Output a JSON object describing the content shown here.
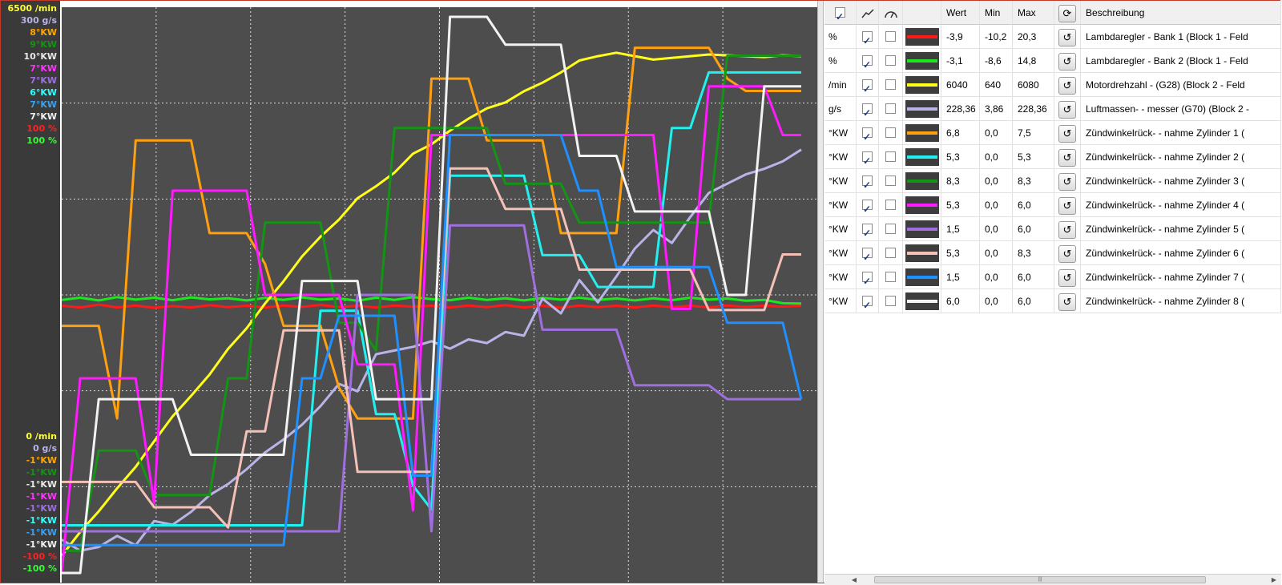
{
  "axis_labels_top": [
    {
      "text": "6500 /min",
      "color": "#ffff33"
    },
    {
      "text": "300 g/s",
      "color": "#b8b4e8"
    },
    {
      "text": "8°KW",
      "color": "#ffa500"
    },
    {
      "text": "9°KW",
      "color": "#149414"
    },
    {
      "text": "10°KW",
      "color": "#e8e8e8"
    },
    {
      "text": "7°KW",
      "color": "#ff33ff"
    },
    {
      "text": "7°KW",
      "color": "#9f6fe0"
    },
    {
      "text": "6°KW",
      "color": "#33ffff"
    },
    {
      "text": "7°KW",
      "color": "#3aa0f0"
    },
    {
      "text": "7°KW",
      "color": "#f0f0f0"
    },
    {
      "text": "100 %",
      "color": "#ff2020"
    },
    {
      "text": "100 %",
      "color": "#33ff33"
    }
  ],
  "axis_labels_bottom": [
    {
      "text": "0 /min",
      "color": "#ffff33"
    },
    {
      "text": "0 g/s",
      "color": "#b8b4e8"
    },
    {
      "text": "-1°KW",
      "color": "#ffa500"
    },
    {
      "text": "-1°KW",
      "color": "#149414"
    },
    {
      "text": "-1°KW",
      "color": "#e8e8e8"
    },
    {
      "text": "-1°KW",
      "color": "#ff33ff"
    },
    {
      "text": "-1°KW",
      "color": "#9f6fe0"
    },
    {
      "text": "-1°KW",
      "color": "#33ffff"
    },
    {
      "text": "-1°KW",
      "color": "#3aa0f0"
    },
    {
      "text": "-1°KW",
      "color": "#f0f0f0"
    },
    {
      "text": "-100 %",
      "color": "#ff2020"
    },
    {
      "text": "-100 %",
      "color": "#33ff33"
    }
  ],
  "chart_data": {
    "type": "line",
    "grid": true,
    "x": [
      0,
      2,
      4,
      6,
      8,
      10,
      12,
      14,
      16,
      18,
      20,
      22,
      24,
      26,
      28,
      30,
      32,
      34,
      36,
      38,
      40,
      42,
      44,
      46,
      48,
      50,
      52,
      54,
      56,
      58,
      60,
      62,
      64,
      66,
      68,
      70,
      72,
      74,
      76,
      78,
      80
    ],
    "series": [
      {
        "name": "Lambdaregler - Bank 1",
        "color": "#ff1a1a",
        "values": [
          -3.9,
          -4.5,
          -3.5,
          -4.5,
          -3.8,
          -4.6,
          -4.0,
          -4.5,
          -3.7,
          -4.4,
          -3.9,
          -4.5,
          -3.8,
          -4.3,
          -3.6,
          -4.4,
          -3.9,
          -4.5,
          -3.8,
          -4.2,
          -3.9,
          -4.5,
          -3.8,
          -4.4,
          -3.7,
          -4.5,
          -3.9,
          -4.6,
          -3.8,
          -4.4,
          -3.9,
          -4.5,
          -3.8,
          -4.4,
          -3.9,
          -4.5,
          -3.8,
          -4.3,
          -3.9,
          -4.2,
          -3.9
        ]
      },
      {
        "name": "Lambdaregler - Bank 2",
        "color": "#1ee61e",
        "values": [
          -1.8,
          -1.0,
          -2.0,
          -0.8,
          -1.7,
          -1.0,
          -1.9,
          -0.9,
          -1.6,
          -1.2,
          -2.0,
          -1.1,
          -1.8,
          -0.9,
          -1.7,
          -1.3,
          -2.1,
          -1.0,
          -1.8,
          -0.8,
          -1.5,
          -1.9,
          -1.0,
          -1.8,
          -1.2,
          -2.0,
          -1.1,
          -1.7,
          -1.0,
          -1.8,
          -1.3,
          -2.0,
          -1.2,
          -1.9,
          -1.0,
          -1.7,
          -1.3,
          -2.1,
          -1.8,
          -3.0,
          -3.1
        ]
      },
      {
        "name": "Motordrehzahl - (G28)",
        "color": "#ffff1a",
        "values": [
          200,
          480,
          720,
          990,
          1240,
          1540,
          1830,
          2070,
          2320,
          2620,
          2860,
          3150,
          3410,
          3700,
          3930,
          4130,
          4380,
          4520,
          4680,
          4900,
          5010,
          5170,
          5310,
          5430,
          5500,
          5630,
          5730,
          5850,
          5990,
          6040,
          6080,
          6040,
          6000,
          6020,
          6040,
          6060,
          6050,
          6040,
          6030,
          6050,
          6040
        ]
      },
      {
        "name": "Luftmassen- - messer (G70)",
        "color": "#b8b4e8",
        "values": [
          18,
          12,
          14,
          20,
          15,
          28,
          26,
          33,
          42,
          48,
          56,
          65,
          72,
          80,
          90,
          102,
          98,
          118,
          120,
          122,
          125,
          121,
          126,
          124,
          130,
          128,
          148,
          140,
          158,
          146,
          160,
          175,
          185,
          178,
          192,
          205,
          210,
          215,
          218,
          222,
          228.36
        ]
      },
      {
        "name": "Zündwinkelrück- - nahme Zylinder 1",
        "color": "#ffa010",
        "values": [
          3.0,
          3.0,
          3.0,
          1.5,
          6.0,
          6.0,
          6.0,
          6.0,
          4.5,
          4.5,
          4.5,
          4.0,
          3.0,
          3.0,
          3.0,
          2.0,
          1.5,
          1.5,
          1.5,
          1.5,
          7.0,
          7.0,
          7.0,
          6.0,
          6.0,
          6.0,
          6.0,
          4.5,
          4.5,
          4.5,
          4.5,
          7.5,
          7.5,
          7.5,
          7.5,
          7.5,
          7.0,
          6.8,
          6.8,
          6.8,
          6.8
        ]
      },
      {
        "name": "Zündwinkelrück- - nahme Zylinder 2",
        "color": "#22f0f0",
        "values": [
          -0.4,
          -0.4,
          -0.4,
          -0.4,
          -0.4,
          -0.4,
          -0.4,
          -0.4,
          -0.4,
          -0.4,
          -0.4,
          -0.4,
          -0.4,
          -0.4,
          2.3,
          2.3,
          2.3,
          1.0,
          1.0,
          0.1,
          -0.2,
          4.0,
          4.0,
          4.0,
          4.0,
          4.0,
          3.0,
          3.0,
          3.0,
          2.6,
          2.6,
          2.6,
          2.6,
          4.6,
          4.6,
          5.3,
          5.3,
          5.3,
          5.3,
          5.3,
          5.3
        ]
      },
      {
        "name": "Zündwinkelrück- - nahme Zylinder 3",
        "color": "#149414",
        "values": [
          -0.6,
          -0.6,
          1.2,
          1.2,
          1.2,
          0.4,
          0.4,
          0.4,
          0.4,
          2.5,
          2.5,
          5.3,
          5.3,
          5.3,
          5.3,
          3.5,
          3.5,
          3.0,
          7.0,
          7.0,
          7.0,
          7.0,
          7.0,
          7.0,
          6.0,
          6.0,
          6.0,
          6.0,
          5.3,
          5.3,
          5.3,
          5.3,
          5.3,
          5.3,
          5.3,
          5.3,
          8.3,
          8.3,
          8.3,
          8.3,
          8.3
        ]
      },
      {
        "name": "Zündwinkelrück- - nahme Zylinder 4",
        "color": "#ff1aff",
        "values": [
          -1.0,
          1.8,
          1.8,
          1.8,
          1.8,
          0.0,
          4.5,
          4.5,
          4.5,
          4.5,
          4.5,
          3.0,
          3.0,
          3.0,
          3.0,
          3.0,
          2.0,
          2.0,
          2.0,
          -0.1,
          5.3,
          5.3,
          5.3,
          5.3,
          5.3,
          5.3,
          5.3,
          5.3,
          5.3,
          5.3,
          5.3,
          5.3,
          5.3,
          2.8,
          2.8,
          6.0,
          6.0,
          6.0,
          6.0,
          5.3,
          5.3
        ]
      },
      {
        "name": "Zündwinkelrück- - nahme Zylinder 5",
        "color": "#9f6fe0",
        "values": [
          -0.4,
          -0.4,
          -0.4,
          -0.4,
          -0.4,
          -0.4,
          -0.4,
          -0.4,
          -0.4,
          -0.4,
          -0.4,
          -0.4,
          -0.4,
          -0.4,
          -0.4,
          -0.4,
          3.0,
          3.0,
          3.0,
          3.0,
          -0.4,
          4.0,
          4.0,
          4.0,
          4.0,
          4.0,
          2.5,
          2.5,
          2.5,
          2.5,
          2.5,
          1.7,
          1.7,
          1.7,
          1.7,
          1.7,
          1.5,
          1.5,
          1.5,
          1.5,
          1.5
        ]
      },
      {
        "name": "Zündwinkelrück- - nahme Zylinder 6",
        "color": "#f5c0b5",
        "values": [
          0.8,
          0.8,
          0.8,
          0.8,
          0.8,
          0.3,
          0.3,
          0.3,
          0.3,
          -0.1,
          1.8,
          1.8,
          3.8,
          3.8,
          3.8,
          3.8,
          1.0,
          1.0,
          1.0,
          1.0,
          1.0,
          7.0,
          7.0,
          7.0,
          6.2,
          6.2,
          6.2,
          6.2,
          5.0,
          5.0,
          5.0,
          5.0,
          5.0,
          5.0,
          5.0,
          4.2,
          4.2,
          4.2,
          4.2,
          5.3,
          5.3
        ]
      },
      {
        "name": "Zündwinkelrück- - nahme Zylinder 7",
        "color": "#1e90ff",
        "values": [
          -0.6,
          -0.6,
          -0.6,
          -0.6,
          -0.6,
          -0.6,
          -0.6,
          -0.6,
          -0.6,
          -0.6,
          -0.6,
          -0.6,
          -0.6,
          1.8,
          1.8,
          2.7,
          2.7,
          2.7,
          2.7,
          0.4,
          0.4,
          5.3,
          5.3,
          5.3,
          5.3,
          5.3,
          5.3,
          5.3,
          4.5,
          4.5,
          3.4,
          3.4,
          3.4,
          3.4,
          3.4,
          3.4,
          2.6,
          2.6,
          2.6,
          2.6,
          1.5
        ]
      },
      {
        "name": "Zündwinkelrück- - nahme Zylinder 8",
        "color": "#f2f2f2",
        "values": [
          -1.0,
          -1.0,
          1.5,
          1.5,
          1.5,
          1.5,
          1.5,
          0.7,
          0.7,
          0.7,
          0.7,
          0.7,
          0.7,
          3.2,
          3.2,
          3.2,
          3.2,
          1.5,
          1.5,
          1.5,
          1.5,
          7.0,
          7.0,
          7.0,
          6.6,
          6.6,
          6.6,
          6.6,
          5.0,
          5.0,
          5.0,
          4.2,
          4.2,
          4.2,
          4.2,
          4.2,
          3.0,
          3.0,
          6.0,
          6.0,
          6.0
        ]
      }
    ]
  },
  "grid_header": {
    "wert": "Wert",
    "min": "Min",
    "max": "Max",
    "beschreibung": "Beschreibung",
    "icons": [
      "select-all-checkbox",
      "line-chart-icon",
      "gauge-icon",
      "refresh-icon"
    ]
  },
  "rows": [
    {
      "unit": "%",
      "visible": true,
      "gauge": false,
      "color": "#ff1a1a",
      "wert": "-3,9",
      "min": "-10,2",
      "max": "20,3",
      "desc": "Lambdaregler - Bank 1 (Block 1 - Feld"
    },
    {
      "unit": "%",
      "visible": true,
      "gauge": false,
      "color": "#1ee61e",
      "wert": "-3,1",
      "min": "-8,6",
      "max": "14,8",
      "desc": "Lambdaregler - Bank 2 (Block 1 - Feld"
    },
    {
      "unit": "/min",
      "visible": true,
      "gauge": false,
      "color": "#ffff1a",
      "wert": "6040",
      "min": "640",
      "max": "6080",
      "desc": "Motordrehzahl - (G28) (Block 2 - Feld"
    },
    {
      "unit": "g/s",
      "visible": true,
      "gauge": false,
      "color": "#b8b4e8",
      "wert": "228,36",
      "min": "3,86",
      "max": "228,36",
      "desc": "Luftmassen- - messer (G70) (Block 2 -"
    },
    {
      "unit": "°KW",
      "visible": true,
      "gauge": false,
      "color": "#ffa010",
      "wert": "6,8",
      "min": "0,0",
      "max": "7,5",
      "desc": "Zündwinkelrück- - nahme Zylinder 1 ("
    },
    {
      "unit": "°KW",
      "visible": true,
      "gauge": false,
      "color": "#22f0f0",
      "wert": "5,3",
      "min": "0,0",
      "max": "5,3",
      "desc": "Zündwinkelrück- - nahme Zylinder 2 ("
    },
    {
      "unit": "°KW",
      "visible": true,
      "gauge": false,
      "color": "#149414",
      "wert": "8,3",
      "min": "0,0",
      "max": "8,3",
      "desc": "Zündwinkelrück- - nahme Zylinder 3 ("
    },
    {
      "unit": "°KW",
      "visible": true,
      "gauge": false,
      "color": "#ff1aff",
      "wert": "5,3",
      "min": "0,0",
      "max": "6,0",
      "desc": "Zündwinkelrück- - nahme Zylinder 4 ("
    },
    {
      "unit": "°KW",
      "visible": true,
      "gauge": false,
      "color": "#9f6fe0",
      "wert": "1,5",
      "min": "0,0",
      "max": "6,0",
      "desc": "Zündwinkelrück- - nahme Zylinder 5 ("
    },
    {
      "unit": "°KW",
      "visible": true,
      "gauge": false,
      "color": "#f5c0b5",
      "wert": "5,3",
      "min": "0,0",
      "max": "8,3",
      "desc": "Zündwinkelrück- - nahme Zylinder 6 ("
    },
    {
      "unit": "°KW",
      "visible": true,
      "gauge": false,
      "color": "#1e90ff",
      "wert": "1,5",
      "min": "0,0",
      "max": "6,0",
      "desc": "Zündwinkelrück- - nahme Zylinder 7 ("
    },
    {
      "unit": "°KW",
      "visible": true,
      "gauge": false,
      "color": "#f2f2f2",
      "wert": "6,0",
      "min": "0,0",
      "max": "6,0",
      "desc": "Zündwinkelrück- - nahme Zylinder 8 ("
    }
  ]
}
